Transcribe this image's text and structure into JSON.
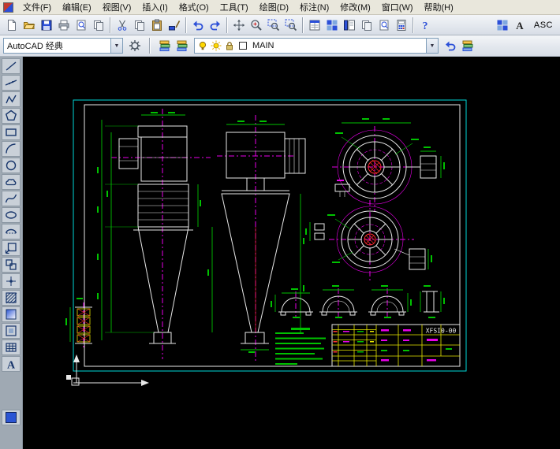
{
  "menu": {
    "items": [
      "文件(F)",
      "编辑(E)",
      "视图(V)",
      "插入(I)",
      "格式(O)",
      "工具(T)",
      "绘图(D)",
      "标注(N)",
      "修改(M)",
      "窗口(W)",
      "帮助(H)"
    ]
  },
  "toolbar1": {
    "icons": [
      "new-file",
      "open",
      "save",
      "plot",
      "plot-preview",
      "publish",
      "|",
      "cut",
      "copy",
      "paste",
      "match-properties",
      "|",
      "undo",
      "redo",
      "|",
      "pan",
      "zoom-realtime",
      "zoom-window",
      "zoom-previous",
      "|",
      "properties",
      "design-center",
      "tool-palettes",
      "sheet-set-manager",
      "markup-set-manager",
      "quick-calc",
      "|",
      "help"
    ],
    "right_icons": [
      "viewports",
      "text-style"
    ],
    "asc_label": "ASC"
  },
  "toolbar2": {
    "workspace": "AutoCAD 经典",
    "icons_after_workspace": [
      "workspace-settings"
    ],
    "layer_tool_icons": [
      "layer-properties",
      "layer-states"
    ],
    "layer": {
      "name": "MAIN",
      "status_icons": [
        "layer-on-bulb-icon",
        "layer-freeze-sun-icon",
        "layer-lock-icon",
        "layer-color-swatch-icon"
      ]
    },
    "right_icons": [
      "layer-previous",
      "make-object-layer-current"
    ]
  },
  "left_toolbar": {
    "icons": [
      "line",
      "construction-line",
      "polyline",
      "polygon",
      "rectangle",
      "arc",
      "circle",
      "revision-cloud",
      "spline",
      "ellipse",
      "ellipse-arc",
      "insert-block",
      "make-block",
      "point",
      "hatch",
      "gradient",
      "region",
      "table",
      "multiline-text",
      "spacer",
      "color-swatch"
    ]
  },
  "drawing": {
    "title_code": "XFSI0-00"
  }
}
